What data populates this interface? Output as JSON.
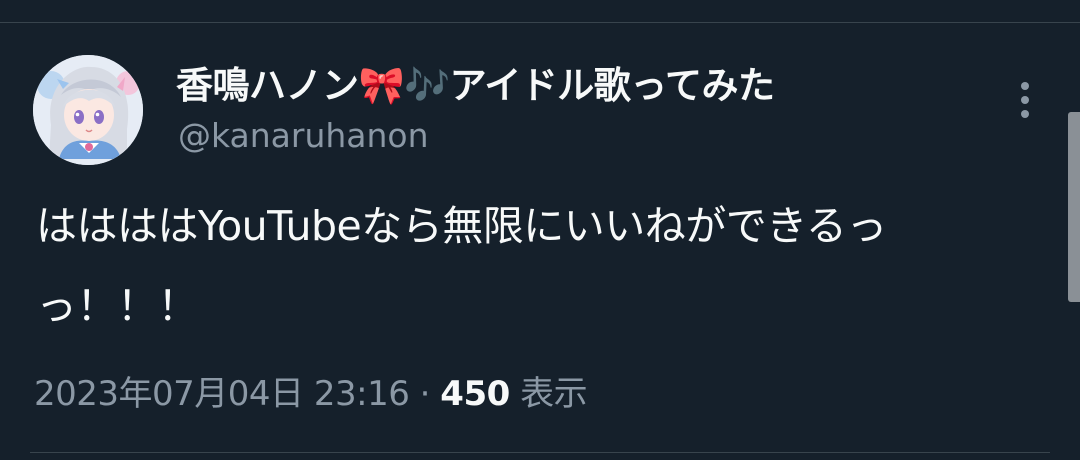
{
  "author": {
    "display_name": "香鳴ハノン🎀🎶アイドル歌ってみた",
    "handle": "@kanaruhanon"
  },
  "tweet": {
    "text": "ははははYouTubeなら無限にいいねができるっっ！！！"
  },
  "meta": {
    "date": "2023年07月04日",
    "time": "23:16",
    "separator": "·",
    "views_count": "450",
    "views_label": "表示"
  },
  "colors": {
    "background": "#15202b",
    "text_primary": "#f7f9f9",
    "text_secondary": "#8b98a5",
    "divider": "#38444d"
  },
  "icons": {
    "more": "more-vertical-icon"
  }
}
